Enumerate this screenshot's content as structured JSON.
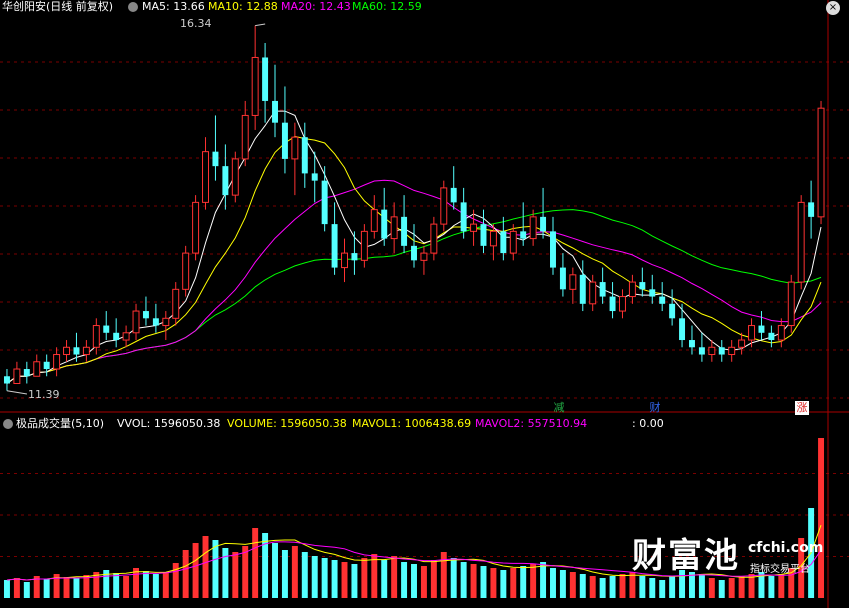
{
  "price_panel": {
    "title": "华创阳安(日线 前复权)",
    "legend": [
      {
        "label": "MA5: 13.66",
        "color": "#ffffff"
      },
      {
        "label": "MA10: 12.88",
        "color": "#ffff00"
      },
      {
        "label": "MA20: 12.43",
        "color": "#ff00ff"
      },
      {
        "label": "MA60: 12.59",
        "color": "#00ff00"
      }
    ],
    "high_marker": "16.34",
    "low_marker": "11.39",
    "tags": [
      {
        "text": "减",
        "color": "#22aa44"
      },
      {
        "text": "财",
        "color": "#3366ee"
      },
      {
        "text": "涨",
        "color": "#dd2222"
      }
    ]
  },
  "volume_panel": {
    "title": "极品成交量(5,10)",
    "legend": [
      {
        "label": "VVOL: 1596050.38",
        "color": "#ffffff"
      },
      {
        "label": "VOLUME: 1596050.38",
        "color": "#ffff00"
      },
      {
        "label": "MAVOL1: 1006438.69",
        "color": "#ffff00"
      },
      {
        "label": "MAVOL2: 557510.94",
        "color": "#ff00ff"
      },
      {
        "label": ": 0.00",
        "color": "#ffffff"
      }
    ]
  },
  "watermark": {
    "brand": "财富池",
    "domain": "cfchi.com",
    "slogan": "指标交易平台"
  },
  "colors": {
    "up": "#ff3232",
    "down": "#54ffff",
    "grid": "#7a0000",
    "ma5": "#ffffff",
    "ma10": "#ffff00",
    "ma20": "#ff00ff",
    "ma60": "#00ff00"
  },
  "chart_data": {
    "type": "candlestick",
    "y_range": [
      11.2,
      16.5
    ],
    "series": [
      {
        "name": "MA5",
        "value": 13.66
      },
      {
        "name": "MA10",
        "value": 12.88
      },
      {
        "name": "MA20",
        "value": 12.43
      },
      {
        "name": "MA60",
        "value": 12.59
      }
    ],
    "candles": [
      [
        11.5,
        11.6,
        11.3,
        11.4
      ],
      [
        11.4,
        11.7,
        11.4,
        11.6
      ],
      [
        11.6,
        11.7,
        11.4,
        11.5
      ],
      [
        11.5,
        11.8,
        11.5,
        11.7
      ],
      [
        11.7,
        11.8,
        11.5,
        11.6
      ],
      [
        11.6,
        11.9,
        11.5,
        11.8
      ],
      [
        11.8,
        12.0,
        11.7,
        11.9
      ],
      [
        11.9,
        12.1,
        11.7,
        11.8
      ],
      [
        11.8,
        12.0,
        11.7,
        11.9
      ],
      [
        11.9,
        12.3,
        11.8,
        12.2
      ],
      [
        12.2,
        12.4,
        12.0,
        12.1
      ],
      [
        12.1,
        12.3,
        11.9,
        12.0
      ],
      [
        12.0,
        12.2,
        11.9,
        12.1
      ],
      [
        12.1,
        12.5,
        12.0,
        12.4
      ],
      [
        12.4,
        12.6,
        12.2,
        12.3
      ],
      [
        12.3,
        12.5,
        12.1,
        12.2
      ],
      [
        12.2,
        12.4,
        12.0,
        12.3
      ],
      [
        12.3,
        12.8,
        12.2,
        12.7
      ],
      [
        12.7,
        13.3,
        12.6,
        13.2
      ],
      [
        13.2,
        14.0,
        13.1,
        13.9
      ],
      [
        13.9,
        14.8,
        13.8,
        14.6
      ],
      [
        14.6,
        15.1,
        14.2,
        14.4
      ],
      [
        14.4,
        14.7,
        13.8,
        14.0
      ],
      [
        14.0,
        14.6,
        13.9,
        14.5
      ],
      [
        14.5,
        15.3,
        14.4,
        15.1
      ],
      [
        15.1,
        16.34,
        14.9,
        15.9
      ],
      [
        15.9,
        16.1,
        15.0,
        15.3
      ],
      [
        15.3,
        15.8,
        14.8,
        15.0
      ],
      [
        15.0,
        15.5,
        14.3,
        14.5
      ],
      [
        14.5,
        15.0,
        14.0,
        14.8
      ],
      [
        14.8,
        15.0,
        14.1,
        14.3
      ],
      [
        14.3,
        14.6,
        13.9,
        14.2
      ],
      [
        14.2,
        14.4,
        13.5,
        13.6
      ],
      [
        13.6,
        13.9,
        12.9,
        13.0
      ],
      [
        13.0,
        13.4,
        12.8,
        13.2
      ],
      [
        13.2,
        13.5,
        12.9,
        13.1
      ],
      [
        13.1,
        13.6,
        13.0,
        13.5
      ],
      [
        13.5,
        14.0,
        13.4,
        13.8
      ],
      [
        13.8,
        14.1,
        13.3,
        13.4
      ],
      [
        13.4,
        13.9,
        13.2,
        13.7
      ],
      [
        13.7,
        14.0,
        13.2,
        13.3
      ],
      [
        13.3,
        13.6,
        13.0,
        13.1
      ],
      [
        13.1,
        13.3,
        12.9,
        13.2
      ],
      [
        13.2,
        13.7,
        13.1,
        13.6
      ],
      [
        13.6,
        14.2,
        13.5,
        14.1
      ],
      [
        14.1,
        14.4,
        13.8,
        13.9
      ],
      [
        13.9,
        14.1,
        13.4,
        13.5
      ],
      [
        13.5,
        13.8,
        13.3,
        13.6
      ],
      [
        13.6,
        13.8,
        13.2,
        13.3
      ],
      [
        13.3,
        13.6,
        13.1,
        13.5
      ],
      [
        13.5,
        13.7,
        13.1,
        13.2
      ],
      [
        13.2,
        13.6,
        13.1,
        13.5
      ],
      [
        13.5,
        13.9,
        13.3,
        13.4
      ],
      [
        13.4,
        13.8,
        13.3,
        13.7
      ],
      [
        13.7,
        14.1,
        13.4,
        13.5
      ],
      [
        13.5,
        13.7,
        12.9,
        13.0
      ],
      [
        13.0,
        13.2,
        12.6,
        12.7
      ],
      [
        12.7,
        13.0,
        12.5,
        12.9
      ],
      [
        12.9,
        13.1,
        12.4,
        12.5
      ],
      [
        12.5,
        12.9,
        12.4,
        12.8
      ],
      [
        12.8,
        13.0,
        12.5,
        12.6
      ],
      [
        12.6,
        12.8,
        12.3,
        12.4
      ],
      [
        12.4,
        12.7,
        12.3,
        12.6
      ],
      [
        12.6,
        12.9,
        12.5,
        12.8
      ],
      [
        12.8,
        13.0,
        12.6,
        12.7
      ],
      [
        12.7,
        12.9,
        12.5,
        12.6
      ],
      [
        12.6,
        12.8,
        12.4,
        12.5
      ],
      [
        12.5,
        12.7,
        12.2,
        12.3
      ],
      [
        12.3,
        12.5,
        11.9,
        12.0
      ],
      [
        12.0,
        12.2,
        11.8,
        11.9
      ],
      [
        11.9,
        12.1,
        11.7,
        11.8
      ],
      [
        11.8,
        12.0,
        11.7,
        11.9
      ],
      [
        11.9,
        12.0,
        11.7,
        11.8
      ],
      [
        11.8,
        12.0,
        11.7,
        11.9
      ],
      [
        11.9,
        12.1,
        11.8,
        12.0
      ],
      [
        12.0,
        12.3,
        11.9,
        12.2
      ],
      [
        12.2,
        12.4,
        12.0,
        12.1
      ],
      [
        12.1,
        12.2,
        11.9,
        12.0
      ],
      [
        12.0,
        12.3,
        11.9,
        12.2
      ],
      [
        12.2,
        12.9,
        12.1,
        12.8
      ],
      [
        12.8,
        14.0,
        12.7,
        13.9
      ],
      [
        13.9,
        14.2,
        13.4,
        13.7
      ],
      [
        13.7,
        15.3,
        13.6,
        15.2
      ]
    ],
    "volumes": [
      18,
      20,
      16,
      22,
      19,
      24,
      21,
      20,
      23,
      26,
      28,
      25,
      22,
      30,
      27,
      24,
      26,
      35,
      48,
      55,
      62,
      58,
      50,
      46,
      52,
      70,
      65,
      55,
      48,
      52,
      46,
      42,
      40,
      38,
      36,
      34,
      40,
      44,
      38,
      42,
      36,
      34,
      32,
      38,
      46,
      40,
      36,
      34,
      32,
      30,
      28,
      30,
      32,
      34,
      36,
      30,
      28,
      26,
      24,
      22,
      20,
      22,
      24,
      26,
      22,
      20,
      18,
      22,
      28,
      26,
      24,
      20,
      18,
      20,
      22,
      24,
      26,
      22,
      24,
      30,
      60,
      90,
      160
    ]
  }
}
